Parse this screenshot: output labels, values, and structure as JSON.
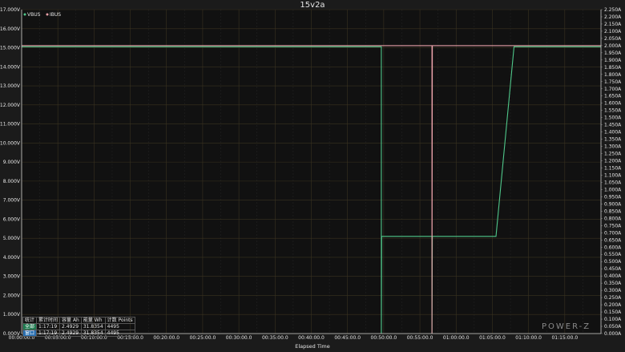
{
  "chart_data": {
    "type": "line",
    "title": "15v2a",
    "xlabel": "Elapsed Time",
    "ylabel_left": "",
    "ylabel_right": "",
    "x_ticks": [
      "00:00:00.0",
      "00:05:00.0",
      "00:10:00.0",
      "00:15:00.0",
      "00:20:00.0",
      "00:25:00.0",
      "00:30:00.0",
      "00:35:00.0",
      "00:40:00.0",
      "00:45:00.0",
      "00:50:00.0",
      "00:55:00.0",
      "01:00:00.0",
      "01:05:00.0",
      "01:10:00.0",
      "01:15:00.0"
    ],
    "xlim_seconds": [
      0,
      4800
    ],
    "y_left_ticks": [
      "0.000V",
      "1.000V",
      "2.000V",
      "3.000V",
      "4.000V",
      "5.000V",
      "6.000V",
      "7.000V",
      "8.000V",
      "9.000V",
      "10.000V",
      "11.000V",
      "12.000V",
      "13.000V",
      "14.000V",
      "15.000V",
      "16.000V",
      "17.000V"
    ],
    "ylim_left": [
      0,
      17
    ],
    "y_right_ticks": [
      "0.000A",
      "0.050A",
      "0.100A",
      "0.150A",
      "0.200A",
      "0.250A",
      "0.300A",
      "0.350A",
      "0.400A",
      "0.450A",
      "0.500A",
      "0.550A",
      "0.600A",
      "0.650A",
      "0.700A",
      "0.750A",
      "0.800A",
      "0.850A",
      "0.900A",
      "0.950A",
      "1.000A",
      "1.050A",
      "1.100A",
      "1.150A",
      "1.200A",
      "1.250A",
      "1.300A",
      "1.350A",
      "1.400A",
      "1.450A",
      "1.500A",
      "1.550A",
      "1.600A",
      "1.650A",
      "1.700A",
      "1.750A",
      "1.800A",
      "1.850A",
      "1.900A",
      "1.950A",
      "2.000A",
      "2.050A",
      "2.100A",
      "2.150A",
      "2.200A",
      "2.250A"
    ],
    "ylim_right": [
      0,
      2.25
    ],
    "grid": true,
    "legend_placement": "top-left",
    "series": [
      {
        "name": "VBUS",
        "axis": "left",
        "color": "#4fc78a",
        "points": [
          [
            0,
            15.05
          ],
          [
            2980,
            15.05
          ],
          [
            2980,
            0
          ],
          [
            2983,
            5.1
          ],
          [
            3400,
            5.1
          ],
          [
            3400,
            0
          ],
          [
            3403,
            5.1
          ],
          [
            3930,
            5.1
          ],
          [
            4080,
            15.05
          ],
          [
            4800,
            15.05
          ]
        ]
      },
      {
        "name": "IBUS",
        "axis": "right",
        "color": "#e8a0a8",
        "points": [
          [
            0,
            2.0
          ],
          [
            3400,
            2.0
          ],
          [
            3400,
            0
          ],
          [
            3403,
            2.0
          ],
          [
            4800,
            2.0
          ]
        ]
      }
    ]
  },
  "stats": {
    "headers": [
      "统计",
      "累计时间",
      "容量 Ah",
      "能量 Wh",
      "计数 Points"
    ],
    "rows": [
      {
        "key": "全部",
        "time": "1:17:19",
        "ah": "2.4929",
        "wh": "31.8354",
        "points": "4495"
      },
      {
        "key": "窗口",
        "time": "1:17:19",
        "ah": "2.4929",
        "wh": "31.8354",
        "points": "4495"
      }
    ]
  },
  "brand": "POWER-Z"
}
